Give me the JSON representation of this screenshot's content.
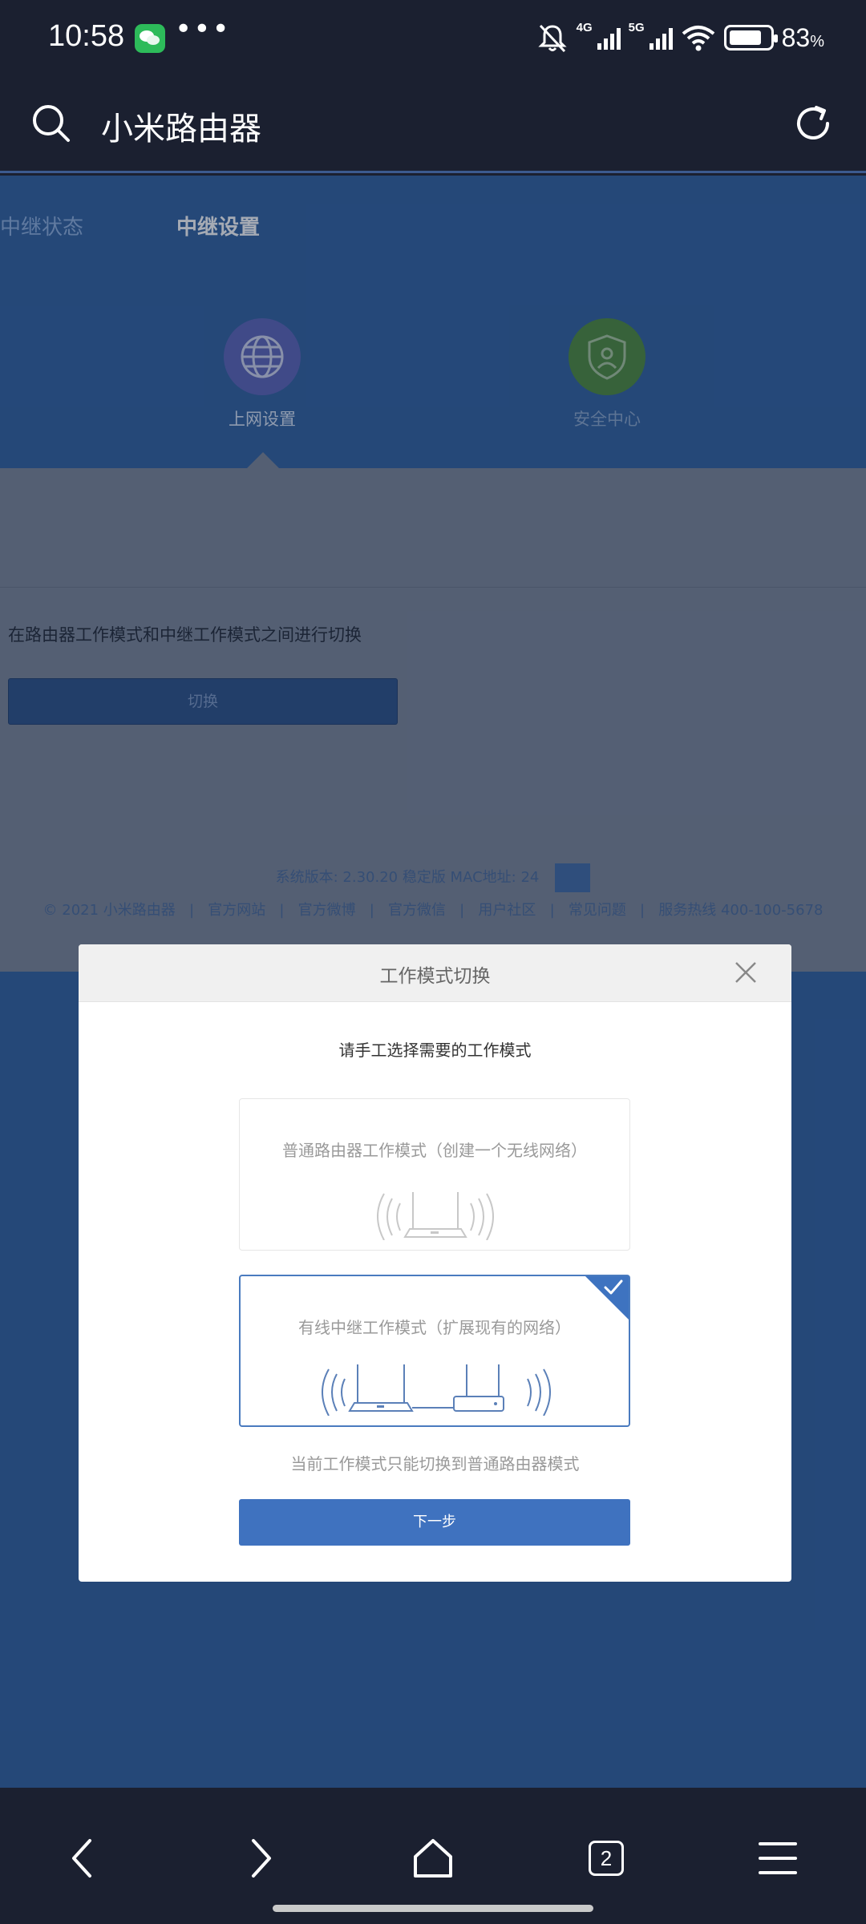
{
  "status_bar": {
    "time": "10:58",
    "dots": "•••",
    "net1": "4G",
    "net2": "5G",
    "battery_text": "83",
    "battery_unit": "%",
    "battery_level": 0.83
  },
  "browser": {
    "title": "小米路由器",
    "tab_count": "2"
  },
  "page": {
    "tabs": [
      "中继状态",
      "中继设置"
    ],
    "features": [
      {
        "label": "上网设置",
        "icon": "globe-icon"
      },
      {
        "label": "安全中心",
        "icon": "shield-icon"
      }
    ],
    "description": "在路由器工作模式和中继工作模式之间进行切换",
    "switch_button": "切换",
    "footer": {
      "version": "系统版本: 2.30.20 稳定版  MAC地址: 24",
      "links": [
        "© 2021 小米路由器",
        "官方网站",
        "官方微博",
        "官方微信",
        "用户社区",
        "常见问题",
        "服务热线 400-100-5678"
      ]
    }
  },
  "modal": {
    "title": "工作模式切换",
    "prompt": "请手工选择需要的工作模式",
    "options": [
      {
        "label": "普通路由器工作模式（创建一个无线网络）",
        "selected": false
      },
      {
        "label": "有线中继工作模式（扩展现有的网络）",
        "selected": true
      }
    ],
    "hint": "当前工作模式只能切换到普通路由器模式",
    "next_button": "下一步"
  },
  "colors": {
    "page_blue": "#2f5f9f",
    "accent": "#3f72bf",
    "dark_bar": "#1b2030"
  }
}
